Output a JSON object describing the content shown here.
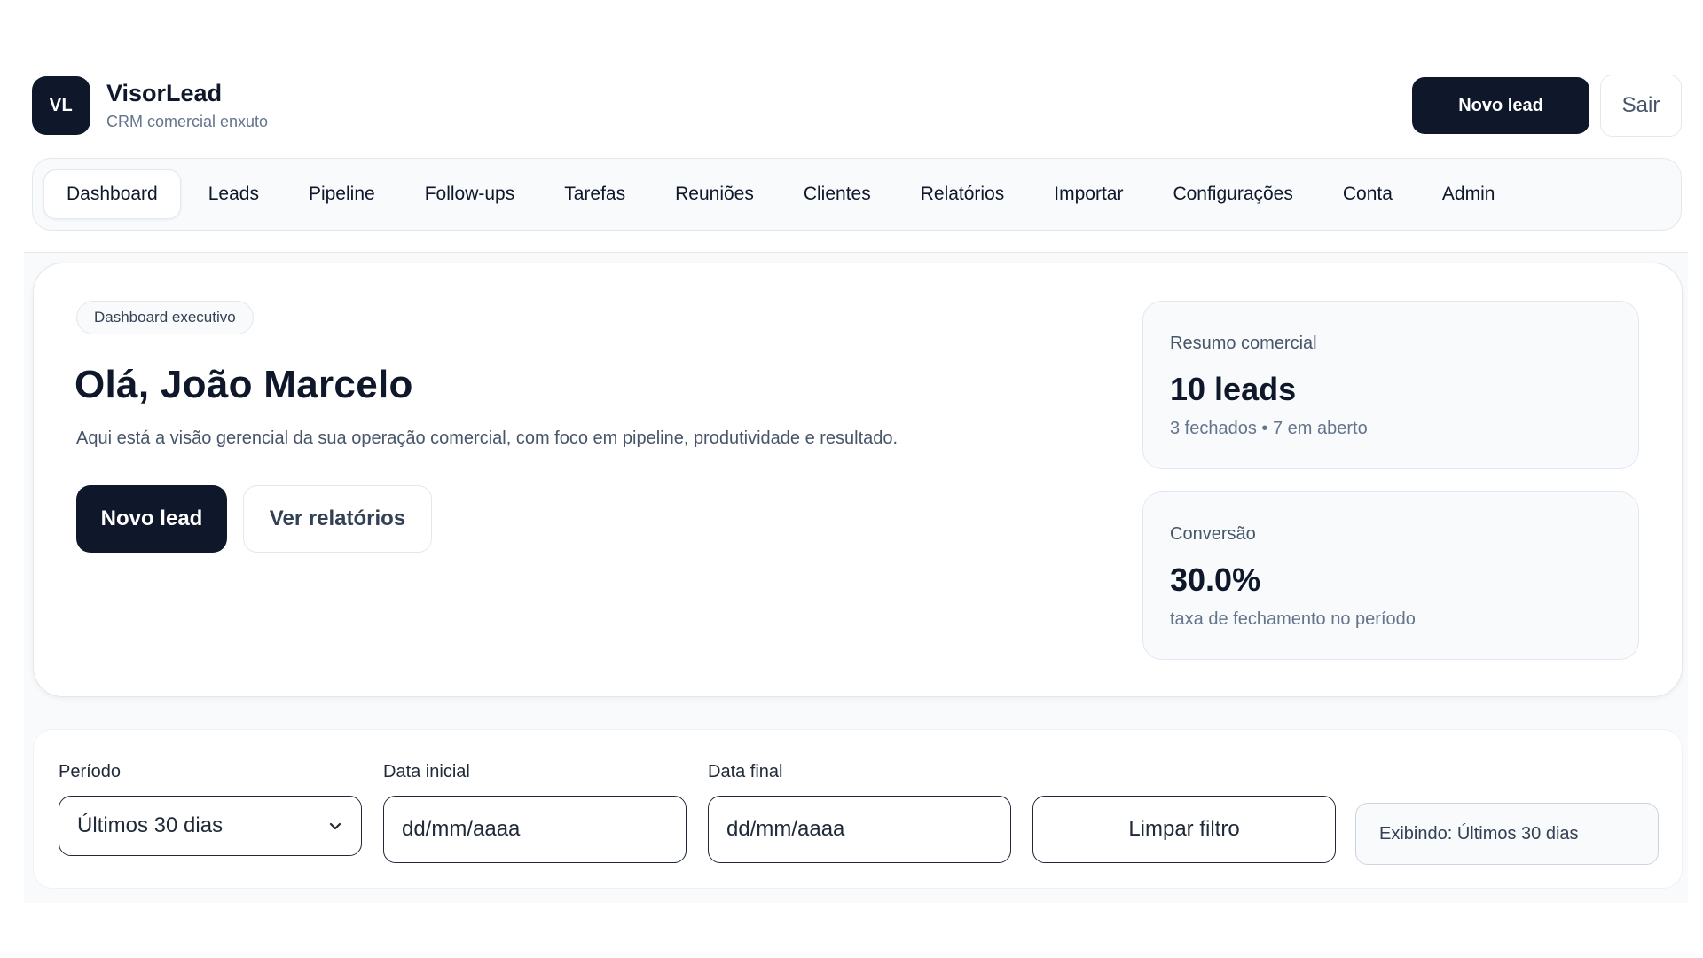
{
  "brand": {
    "logo_text": "VL",
    "name": "VisorLead",
    "subtitle": "CRM comercial enxuto"
  },
  "header": {
    "new_lead_label": "Novo lead",
    "exit_label": "Sair"
  },
  "nav": {
    "tabs": [
      {
        "label": "Dashboard",
        "active": true
      },
      {
        "label": "Leads"
      },
      {
        "label": "Pipeline"
      },
      {
        "label": "Follow-ups"
      },
      {
        "label": "Tarefas"
      },
      {
        "label": "Reuniões"
      },
      {
        "label": "Clientes"
      },
      {
        "label": "Relatórios"
      },
      {
        "label": "Importar"
      },
      {
        "label": "Configurações"
      },
      {
        "label": "Conta"
      },
      {
        "label": "Admin"
      }
    ]
  },
  "hero": {
    "badge": "Dashboard executivo",
    "title": "Olá, João Marcelo",
    "description": "Aqui está a visão gerencial da sua operação comercial, com foco em pipeline, produtividade e resultado.",
    "new_lead_label": "Novo lead",
    "reports_label": "Ver relatórios"
  },
  "stats": {
    "summary": {
      "label": "Resumo comercial",
      "value": "10 leads",
      "sub": "3 fechados • 7 em aberto"
    },
    "conversion": {
      "label": "Conversão",
      "value": "30.0%",
      "sub": "taxa de fechamento no período"
    }
  },
  "filters": {
    "period_label": "Período",
    "period_value": "Últimos 30 dias",
    "start_label": "Data inicial",
    "start_placeholder": "dd/mm/aaaa",
    "end_label": "Data final",
    "end_placeholder": "dd/mm/aaaa",
    "clear_label": "Limpar filtro",
    "showing_text": "Exibindo: Últimos 30 dias"
  },
  "colors": {
    "primary": "#0f172a",
    "muted": "#64748b",
    "surface": "#f8fafc",
    "border": "#e2e8f0"
  }
}
